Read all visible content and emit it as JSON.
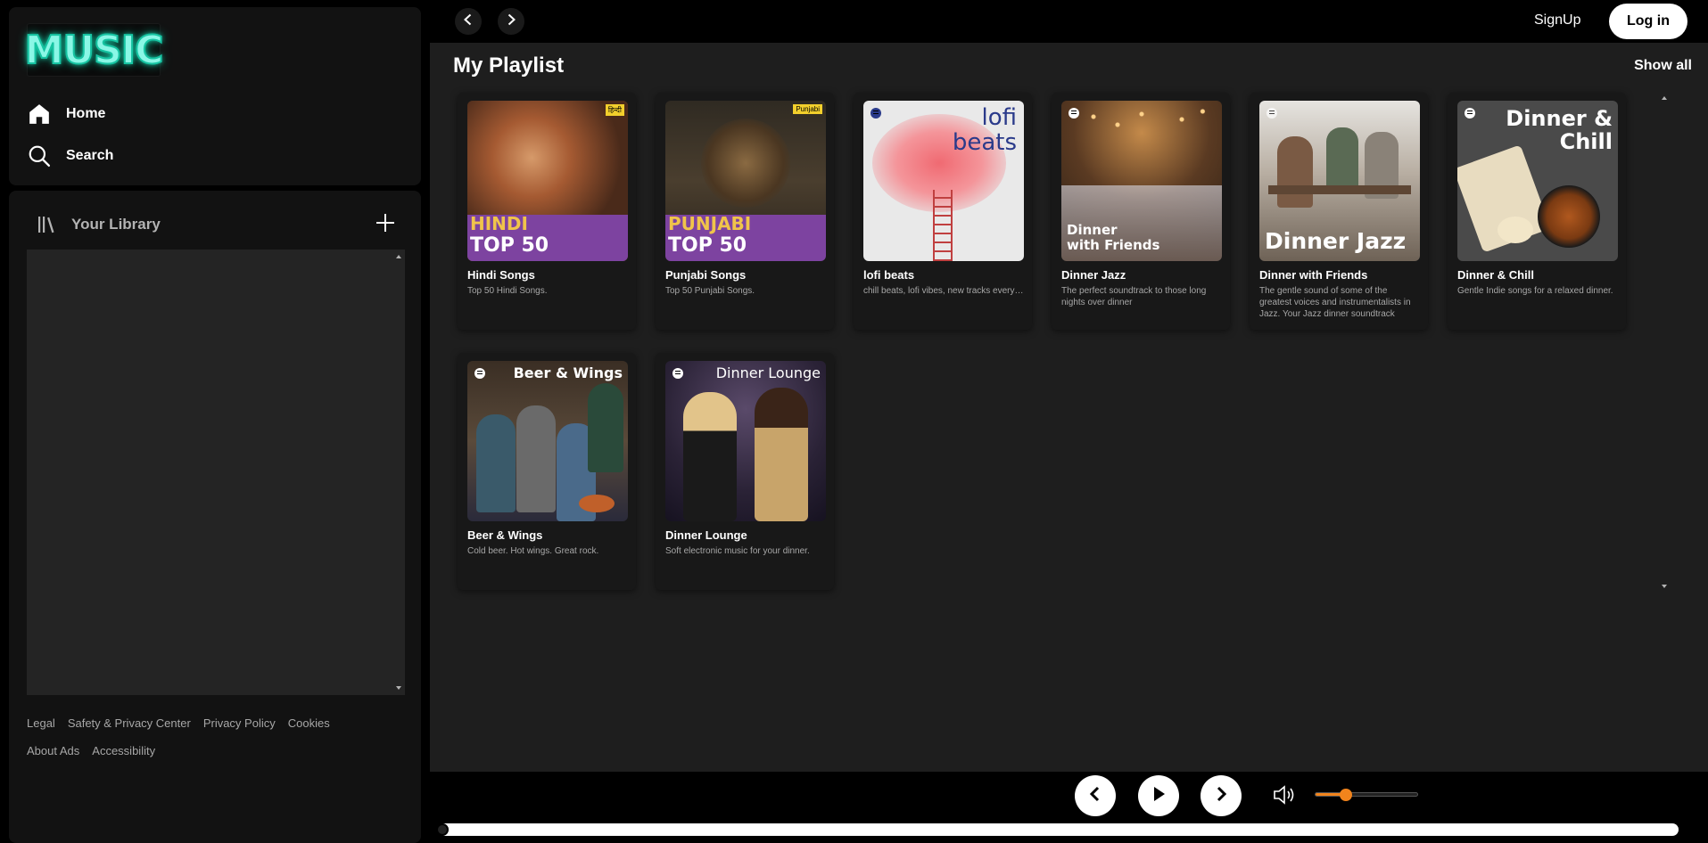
{
  "brand": {
    "logo_text": "MUSIC"
  },
  "nav": {
    "home": "Home",
    "search": "Search"
  },
  "library": {
    "title": "Your Library"
  },
  "footer": {
    "row1": [
      "Legal",
      "Safety & Privacy Center",
      "Privacy Policy",
      "Cookies"
    ],
    "row2": [
      "About Ads",
      "Accessibility"
    ]
  },
  "header": {
    "signup": "SignUp",
    "login": "Log in"
  },
  "section": {
    "title": "My Playlist",
    "show_all": "Show all"
  },
  "playlists": [
    {
      "title": "Hindi Songs",
      "desc": "Top 50 Hindi Songs.",
      "cover_text": [
        "HINDI",
        "TOP 50"
      ],
      "badge": "हिन्दी"
    },
    {
      "title": "Punjabi Songs",
      "desc": "Top 50 Punjabi Songs.",
      "cover_text": [
        "PUNJABI",
        "TOP 50"
      ],
      "badge": "Punjabi"
    },
    {
      "title": "lofi beats",
      "desc": "chill beats, lofi vibes, new tracks every week...",
      "cover_text": [
        "lofi",
        "beats"
      ]
    },
    {
      "title": "Dinner Jazz",
      "desc": "The perfect soundtrack to those long nights over dinner",
      "cover_text": [
        "Dinner",
        "with Friends"
      ]
    },
    {
      "title": "Dinner with Friends",
      "desc": "The gentle sound of some of the greatest voices and instrumentalists in Jazz. Your Jazz dinner soundtrack",
      "cover_text": [
        "Dinner Jazz"
      ]
    },
    {
      "title": "Dinner & Chill",
      "desc": "Gentle Indie songs for a relaxed dinner.",
      "cover_text": [
        "Dinner &",
        "Chill"
      ]
    },
    {
      "title": "Beer & Wings",
      "desc": "Cold beer. Hot wings. Great rock.",
      "cover_text": [
        "Beer & Wings"
      ]
    },
    {
      "title": "Dinner Lounge",
      "desc": "Soft electronic music for your dinner.",
      "cover_text": [
        "Dinner Lounge"
      ]
    }
  ],
  "player": {
    "volume_percent": 30,
    "progress_percent": 0,
    "accent_color": "#f2841c"
  }
}
